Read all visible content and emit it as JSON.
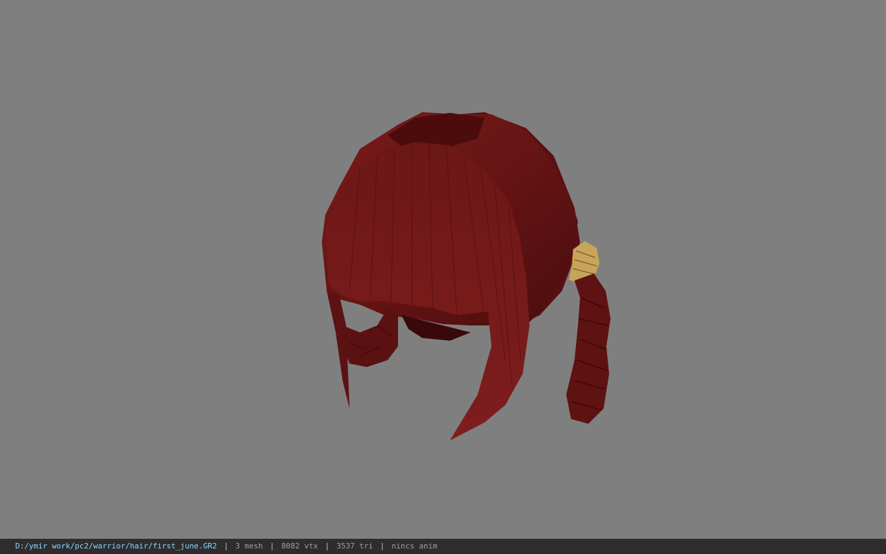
{
  "viewport": {
    "background": "#7f7f7f",
    "model": {
      "description_label": "hair-model",
      "hair_color": "#6f1616",
      "hair_shadow": "#3e0a0a",
      "hair_highlight": "#8a2424",
      "band_color": "#c8a45a"
    }
  },
  "statusbar": {
    "file_path": "D:/ymir work/pc2/warrior/hair/first_june.GR2",
    "separator": "|",
    "mesh_count": "3 mesh",
    "vertex_count": "8082 vtx",
    "triangle_count": "3537 tri",
    "anim_status": "nincs anim",
    "path_color": "#8fd3ff"
  }
}
